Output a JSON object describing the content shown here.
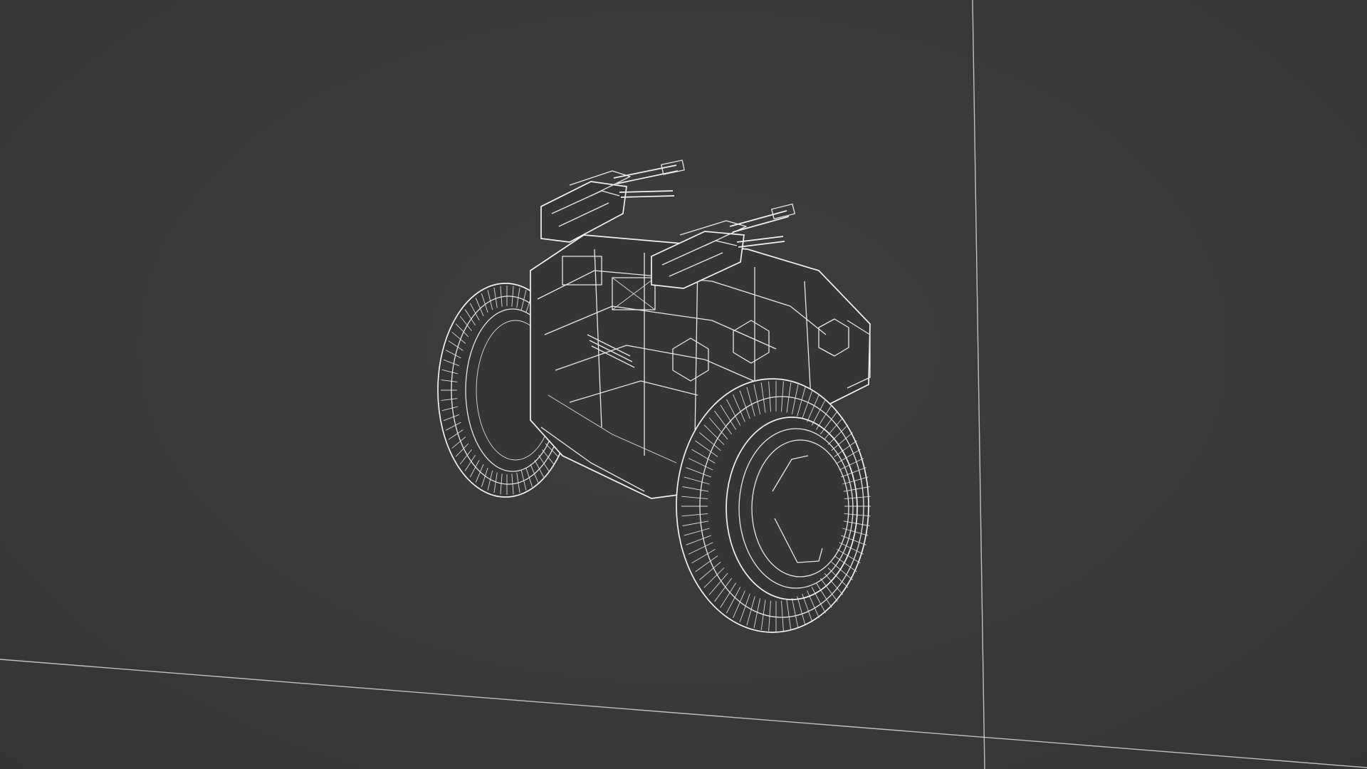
{
  "viewport": {
    "background": "#3a3a3a",
    "wire_color": "#e8e8e8",
    "guide_color": "#cfcfcf"
  },
  "scene": {
    "object": "wireframe-rover-model",
    "parts": [
      "left-wheel-icon",
      "right-wheel-icon",
      "hull",
      "turret-left",
      "turret-right"
    ]
  }
}
